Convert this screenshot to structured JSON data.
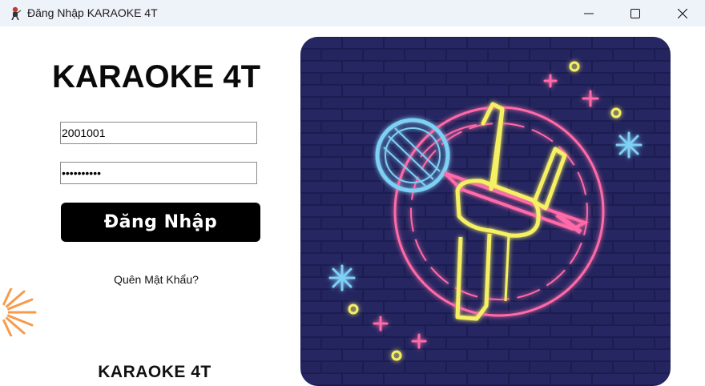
{
  "window": {
    "title": "Đăng Nhập KARAOKE 4T",
    "controls": [
      "minimize-icon",
      "maximize-icon",
      "close-icon"
    ]
  },
  "login": {
    "heading": "KARAOKE 4T",
    "username_value": "2001001",
    "password_value": "••••••••••",
    "login_label": "Đăng Nhập",
    "forgot_label": "Quên Mật Khẩu?",
    "footer_text": "KARAOKE 4T"
  },
  "illustration": {
    "icon": "neon-microphone-hand-icon"
  },
  "colors": {
    "titlebar": "#eef2f9",
    "button": "#000000",
    "wall": "#1c1d52",
    "neon_yellow": "#f6f063",
    "neon_blue": "#7fd0f5",
    "neon_pink": "#ff6aa8",
    "deco_orange": "#f79a4a"
  }
}
